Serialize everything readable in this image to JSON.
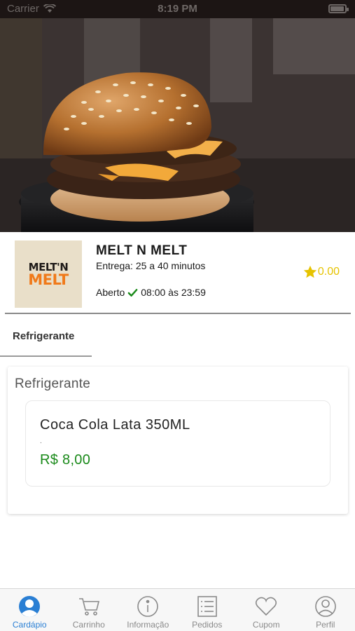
{
  "status_bar": {
    "carrier": "Carrier",
    "time": "8:19 PM"
  },
  "store": {
    "logo_line1": "MELT'N",
    "logo_line2": "MELT",
    "name": "MELT N MELT",
    "delivery": "Entrega: 25 a 40 minutos",
    "status": "Aberto",
    "hours": "08:00 às 23:59",
    "rating": "0.00"
  },
  "category_tabs": [
    {
      "label": "Refrigerante"
    }
  ],
  "categories": [
    {
      "title": "Refrigerante",
      "products": [
        {
          "name": "Coca Cola Lata 350ML",
          "description": ".",
          "price": "R$ 8,00"
        }
      ]
    }
  ],
  "tab_bar": [
    {
      "label": "Cardápio",
      "icon": "menu-user-icon",
      "active": true
    },
    {
      "label": "Carrinho",
      "icon": "cart-icon"
    },
    {
      "label": "Informação",
      "icon": "info-icon"
    },
    {
      "label": "Pedidos",
      "icon": "orders-list-icon"
    },
    {
      "label": "Cupom",
      "icon": "heart-icon"
    },
    {
      "label": "Perfil",
      "icon": "profile-icon"
    }
  ],
  "colors": {
    "accent": "#2a7fd4",
    "price": "#1a8a1a",
    "rating": "#e6c300",
    "open_check": "#1a8a1a"
  }
}
